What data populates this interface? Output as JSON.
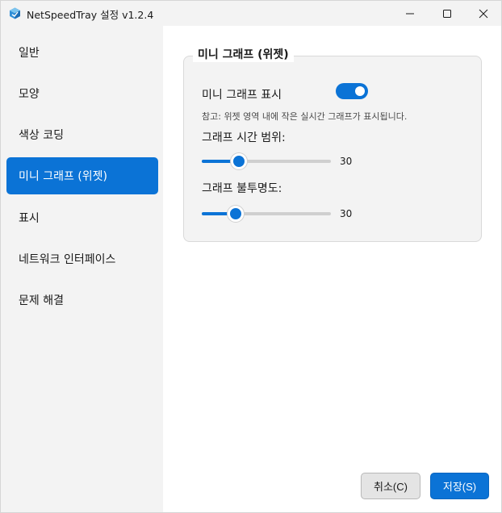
{
  "window": {
    "title": "NetSpeedTray 설정 v1.2.4"
  },
  "sidebar": {
    "items": [
      {
        "label": "일반",
        "active": false
      },
      {
        "label": "모양",
        "active": false
      },
      {
        "label": "색상 코딩",
        "active": false
      },
      {
        "label": "미니 그래프 (위젯)",
        "active": true
      },
      {
        "label": "표시",
        "active": false
      },
      {
        "label": "네트워크 인터페이스",
        "active": false
      },
      {
        "label": "문제 해결",
        "active": false
      }
    ]
  },
  "mini_graph": {
    "group_title": "미니 그래프 (위젯)",
    "show_label": "미니 그래프 표시",
    "show_enabled": true,
    "note": "참고: 위젯 영역 내에 작은 실시간 그래프가 표시됩니다.",
    "time_range_label": "그래프 시간 범위:",
    "time_range_value": "30",
    "time_range_fraction": 0.29,
    "opacity_label": "그래프 불투명도:",
    "opacity_value": "30",
    "opacity_fraction": 0.26
  },
  "footer": {
    "cancel_label": "취소(C)",
    "save_label": "저장(S)"
  },
  "colors": {
    "accent": "#0b73d6",
    "sidebar_bg": "#f3f3f3",
    "content_bg": "#ffffff"
  },
  "icons": [
    "app-logo-icon",
    "minimize-icon",
    "maximize-icon",
    "close-icon"
  ]
}
